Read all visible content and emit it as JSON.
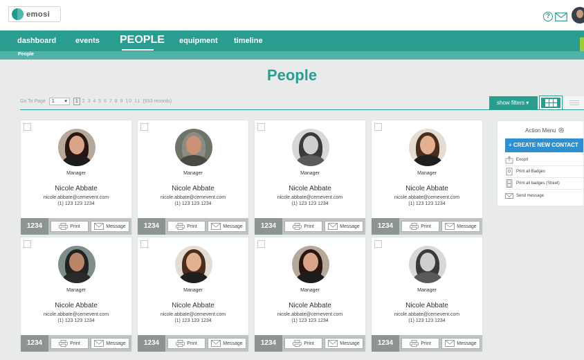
{
  "app": {
    "logo_text": "emosi"
  },
  "header": {
    "help_icon": "question-circle-icon",
    "mail_icon": "envelope-icon",
    "avatar": "user-avatar"
  },
  "nav": {
    "items": [
      {
        "label": "dashboard"
      },
      {
        "label": "events"
      },
      {
        "label": "PEOPLE",
        "active": true
      },
      {
        "label": "equipment"
      },
      {
        "label": "timeline"
      }
    ]
  },
  "breadcrumb": {
    "label": "People"
  },
  "page": {
    "title": "People"
  },
  "pager": {
    "label": "Go To Page",
    "selected": "1",
    "current": "1",
    "pages": "2 3 4 5 6 7 8 9 10 11",
    "records": "(933 records)"
  },
  "toolbar": {
    "filters_label": "show filters",
    "grid_view_icon": "grid-icon",
    "list_view_icon": "list-icon"
  },
  "cards": [
    {
      "role": "Manager",
      "name": "Nicole Abbate",
      "email": "nicole.abbate@cemevent.com",
      "phone": "(1) 123 123 1234",
      "id": "1234",
      "print_label": "Print",
      "message_label": "Message",
      "photo": {
        "bg": "#b7a89c",
        "hair": "#2a1610",
        "skin": "#d9a489",
        "shirt": "#1c1c1c"
      }
    },
    {
      "role": "Manager",
      "name": "Nicole Abbate",
      "email": "nicole.abbate@cemevent.com",
      "phone": "(1) 123 123 1234",
      "id": "1234",
      "print_label": "Print",
      "message_label": "Message",
      "photo": {
        "bg": "#6f7468",
        "hair": "#8c8c84",
        "skin": "#c99274",
        "shirt": "#4a4a42"
      }
    },
    {
      "role": "Manager",
      "name": "Nicole Abbate",
      "email": "nicole.abbate@cemevent.com",
      "phone": "(1) 123 123 1234",
      "id": "1234",
      "print_label": "Print",
      "message_label": "Message",
      "photo": {
        "bg": "#d8d8d8",
        "hair": "#3a3a3a",
        "skin": "#cfcfcf",
        "shirt": "#5a5a5a"
      }
    },
    {
      "role": "Manager",
      "name": "Nicole Abbate",
      "email": "nicole.abbate@cemevent.com",
      "phone": "(1) 123 123 1234",
      "id": "1234",
      "print_label": "Print",
      "message_label": "Message",
      "photo": {
        "bg": "#e3ddd4",
        "hair": "#4a2d1c",
        "skin": "#e3b090",
        "shirt": "#1f1f1f"
      }
    },
    {
      "role": "Manager",
      "name": "Nicole Abbate",
      "email": "nicole.abbate@cemevent.com",
      "phone": "(1) 123 123 1234",
      "id": "1234",
      "print_label": "Print",
      "message_label": "Message",
      "photo": {
        "bg": "#7e8e8a",
        "hair": "#222222",
        "skin": "#b98468",
        "shirt": "#2a2a2a"
      }
    },
    {
      "role": "Manager",
      "name": "Nicole Abbate",
      "email": "nicole.abbate@cemevent.com",
      "phone": "(1) 123 123 1234",
      "id": "1234",
      "print_label": "Print",
      "message_label": "Message",
      "photo": {
        "bg": "#e3ddd4",
        "hair": "#4a2d1c",
        "skin": "#e3b090",
        "shirt": "#1f1f1f"
      }
    },
    {
      "role": "Manager",
      "name": "Nicole Abbate",
      "email": "nicole.abbate@cemevent.com",
      "phone": "(1) 123 123 1234",
      "id": "1234",
      "print_label": "Print",
      "message_label": "Message",
      "photo": {
        "bg": "#b7a89c",
        "hair": "#2a1610",
        "skin": "#d9a489",
        "shirt": "#1c1c1c"
      }
    },
    {
      "role": "Manager",
      "name": "Nicole Abbate",
      "email": "nicole.abbate@cemevent.com",
      "phone": "(1) 123 123 1234",
      "id": "1234",
      "print_label": "Print",
      "message_label": "Message",
      "photo": {
        "bg": "#d8d8d8",
        "hair": "#3a3a3a",
        "skin": "#cfcfcf",
        "shirt": "#5a5a5a"
      }
    }
  ],
  "action_menu": {
    "title": "Action Menu",
    "title_icon": "gear-icon",
    "create_label": "+ CREATE NEW CONTACT",
    "items": [
      {
        "label": "Exoprt",
        "icon": "export-icon"
      },
      {
        "label": "Print all Badges",
        "icon": "badge-icon"
      },
      {
        "label": "Print all badges (Sheet)",
        "icon": "badge-sheet-icon"
      },
      {
        "label": "Send message",
        "icon": "envelope-icon"
      }
    ]
  },
  "colors": {
    "brand": "#2a9d91",
    "brand_light": "#4fb3a8",
    "accent_blue": "#2f8fcf",
    "card_id_bg": "#8d9494"
  }
}
